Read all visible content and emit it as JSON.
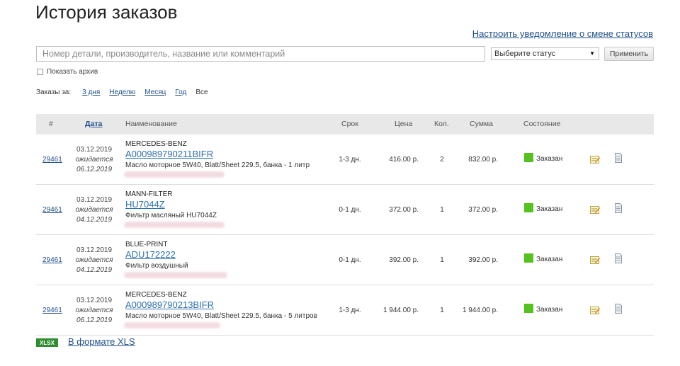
{
  "page": {
    "title": "История заказов"
  },
  "notify_link": "Настроить уведомление о смене статусов",
  "search": {
    "placeholder": "Номер детали, производитель, название или комментарий"
  },
  "status_select": {
    "value": "Выберите статус"
  },
  "apply_button": "Применить",
  "archive": {
    "label": "Показать архив"
  },
  "period": {
    "label": "Заказы за:",
    "options": [
      "3 дня",
      "Неделю",
      "Месяц",
      "Год",
      "Все"
    ],
    "active": "Все"
  },
  "table": {
    "headers": {
      "num": "#",
      "date": "Дата",
      "name": "Наименование",
      "term": "Срок",
      "price": "Цена",
      "qty": "Кол.",
      "sum": "Сумма",
      "state": "Состояние"
    },
    "rows": [
      {
        "order": "29461",
        "date": "03.12.2019",
        "expected_label": "ожидается",
        "expected": "06.12.2019",
        "brand": "MERCEDES-BENZ",
        "part": "A000989790211BIFR",
        "desc": "Масло моторное 5W40, Blatt/Sheet 229.5, банка - 1 литр",
        "term": "1-3 дн.",
        "price": "416.00 р.",
        "qty": "2",
        "sum": "832.00 р.",
        "state": "Заказан"
      },
      {
        "order": "29461",
        "date": "03.12.2019",
        "expected_label": "ожидается",
        "expected": "04.12.2019",
        "brand": "MANN-FILTER",
        "part": "HU7044Z",
        "desc": "Фильтр масляный HU7044Z",
        "term": "0-1 дн.",
        "price": "372.00 р.",
        "qty": "1",
        "sum": "372.00 р.",
        "state": "Заказан"
      },
      {
        "order": "29461",
        "date": "03.12.2019",
        "expected_label": "ожидается",
        "expected": "04.12.2019",
        "brand": "BLUE-PRINT",
        "part": "ADU172222",
        "desc": "Фильтр воздушный",
        "term": "0-1 дн.",
        "price": "392.00 р.",
        "qty": "1",
        "sum": "392.00 р.",
        "state": "Заказан"
      },
      {
        "order": "29461",
        "date": "03.12.2019",
        "expected_label": "ожидается",
        "expected": "06.12.2019",
        "brand": "MERCEDES-BENZ",
        "part": "A000989790213BIFR",
        "desc": "Масло моторное 5W40, Blatt/Sheet 229.5, банка - 5 литров",
        "term": "1-3 дн.",
        "price": "1 944.00 р.",
        "qty": "1",
        "sum": "1 944.00 р.",
        "state": "Заказан"
      }
    ]
  },
  "export": {
    "badge": "XLSX",
    "link": "В формате XLS"
  },
  "colors": {
    "link": "#1f4f8c",
    "status_ordered": "#55c21f",
    "header_bg": "#e8e8e8",
    "xls_badge": "#2f8d2f"
  },
  "icons": {
    "edit": "edit-note-icon",
    "doc": "document-icon"
  }
}
